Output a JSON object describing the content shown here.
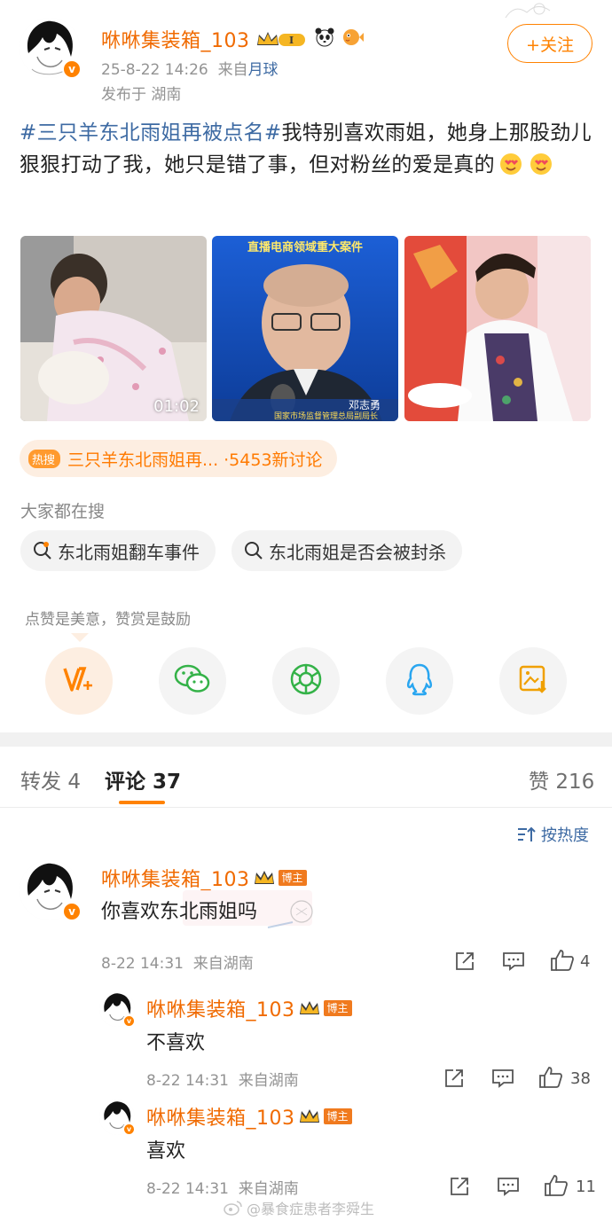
{
  "post": {
    "author": "咻咻集装箱_103",
    "timestamp": "25-8-22 14:26",
    "source_prefix": "来自",
    "source": "月球",
    "location": "发布于 湖南",
    "follow_label": "+关注",
    "hashtag": "#三只羊东北雨姐再被点名#",
    "body": "我特别喜欢雨姐，她身上那股劲儿狠狠打动了我，她只是错了事，但对粉丝的爱是真的",
    "video_duration": "01:02",
    "image2_banner": "直播电商领域重大案件",
    "image2_caption_name": "邓志勇",
    "image2_caption_title": "国家市场监督管理总局副局长"
  },
  "hot_search": {
    "label": "热搜",
    "topic": "三只羊东北雨姐再...",
    "count": "·5453新讨论"
  },
  "related": {
    "title": "大家都在搜",
    "items": [
      "东北雨姐翻车事件",
      "东北雨姐是否会被封杀"
    ]
  },
  "reward_tip": "点赞是美意，赞赏是鼓励",
  "share_icons": [
    "reward-v-plus-icon",
    "wechat-icon",
    "moments-icon",
    "qq-icon",
    "save-image-icon"
  ],
  "tabs": {
    "repost_label": "转发",
    "repost_count": "4",
    "comment_label": "评论",
    "comment_count": "37",
    "like_label": "赞",
    "like_count": "216"
  },
  "sort_label": "按热度",
  "comments": [
    {
      "author": "咻咻集装箱_103",
      "badge": "博主",
      "text": "你喜欢东北雨姐吗",
      "time": "8-22 14:31",
      "source": "来自湖南",
      "likes": "4"
    },
    {
      "author": "咻咻集装箱_103",
      "badge": "博主",
      "text": "不喜欢",
      "time": "8-22 14:31",
      "source": "来自湖南",
      "likes": "38"
    },
    {
      "author": "咻咻集装箱_103",
      "badge": "博主",
      "text": "喜欢",
      "time": "8-22 14:31",
      "source": "来自湖南",
      "likes": "11"
    }
  ],
  "watermark": "@暴食症患者李舜生",
  "colors": {
    "accent": "#ff8200",
    "username": "#f06a00",
    "link": "#3d6aa3"
  }
}
